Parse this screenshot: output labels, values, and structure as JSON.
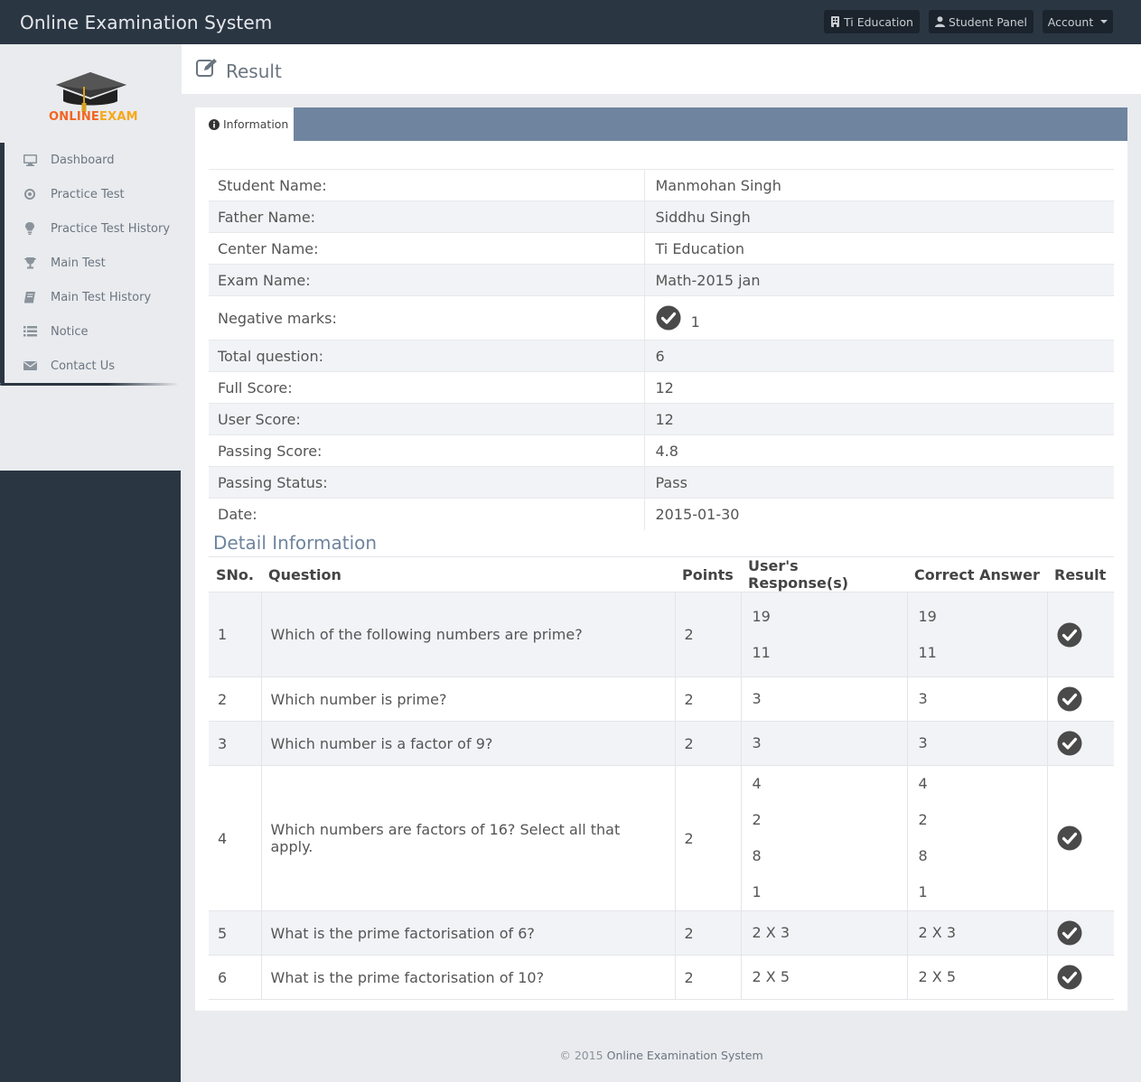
{
  "header": {
    "brand": "Online Examination System",
    "center_label": "Ti Education",
    "panel_label": "Student Panel",
    "account_label": "Account"
  },
  "logo": {
    "text_a": "ONLINE",
    "text_b": "EXAM"
  },
  "sidebar": {
    "items": [
      {
        "label": "Dashboard",
        "icon": "monitor-icon"
      },
      {
        "label": "Practice Test",
        "icon": "target-icon"
      },
      {
        "label": "Practice Test History",
        "icon": "lightbulb-icon"
      },
      {
        "label": "Main Test",
        "icon": "trophy-icon"
      },
      {
        "label": "Main Test History",
        "icon": "book-icon"
      },
      {
        "label": "Notice",
        "icon": "list-icon"
      },
      {
        "label": "Contact Us",
        "icon": "envelope-icon"
      }
    ]
  },
  "page": {
    "title": "Result"
  },
  "panel": {
    "tab_label": "Information"
  },
  "info": {
    "student_name_label": "Student Name:",
    "student_name": "Manmohan Singh",
    "father_name_label": "Father Name:",
    "father_name": "Siddhu Singh",
    "center_name_label": "Center Name:",
    "center_name": "Ti Education",
    "exam_name_label": "Exam Name:",
    "exam_name": "Math-2015 jan",
    "negative_marks_label": "Negative marks:",
    "negative_marks": "1",
    "total_question_label": "Total question:",
    "total_question": "6",
    "full_score_label": "Full Score:",
    "full_score": "12",
    "user_score_label": "User Score:",
    "user_score": "12",
    "passing_score_label": "Passing Score:",
    "passing_score": "4.8",
    "passing_status_label": "Passing Status:",
    "passing_status": "Pass",
    "date_label": "Date:",
    "date": "2015-01-30"
  },
  "detail": {
    "title": "Detail Information",
    "headers": {
      "sno": "SNo.",
      "question": "Question",
      "points": "Points",
      "response": "User's Response(s)",
      "correct": "Correct Answer",
      "result": "Result"
    },
    "rows": [
      {
        "sno": "1",
        "question": "Which of the following numbers are prime?",
        "points": "2",
        "response": [
          "19",
          "11"
        ],
        "correct": [
          "19",
          "11"
        ]
      },
      {
        "sno": "2",
        "question": "Which number is prime?",
        "points": "2",
        "response": [
          "3"
        ],
        "correct": [
          "3"
        ]
      },
      {
        "sno": "3",
        "question": "Which number is a factor of 9?",
        "points": "2",
        "response": [
          "3"
        ],
        "correct": [
          "3"
        ]
      },
      {
        "sno": "4",
        "question": "Which numbers are factors of 16? Select all that apply.",
        "points": "2",
        "response": [
          "4",
          "2",
          "8",
          "1"
        ],
        "correct": [
          "4",
          "2",
          "8",
          "1"
        ]
      },
      {
        "sno": "5",
        "question": "What is the prime factorisation of 6?",
        "points": "2",
        "response": [
          "2 X 3"
        ],
        "correct": [
          "2 X 3"
        ]
      },
      {
        "sno": "6",
        "question": "What is the prime factorisation of 10?",
        "points": "2",
        "response": [
          "2 X 5"
        ],
        "correct": [
          "2 X 5"
        ]
      }
    ]
  },
  "footer": {
    "copyright": "© 2015",
    "system": "Online Examination System"
  },
  "colors": {
    "navbar": "#2b3643",
    "panel_head": "#6f859f",
    "accent": "#6f859f"
  }
}
